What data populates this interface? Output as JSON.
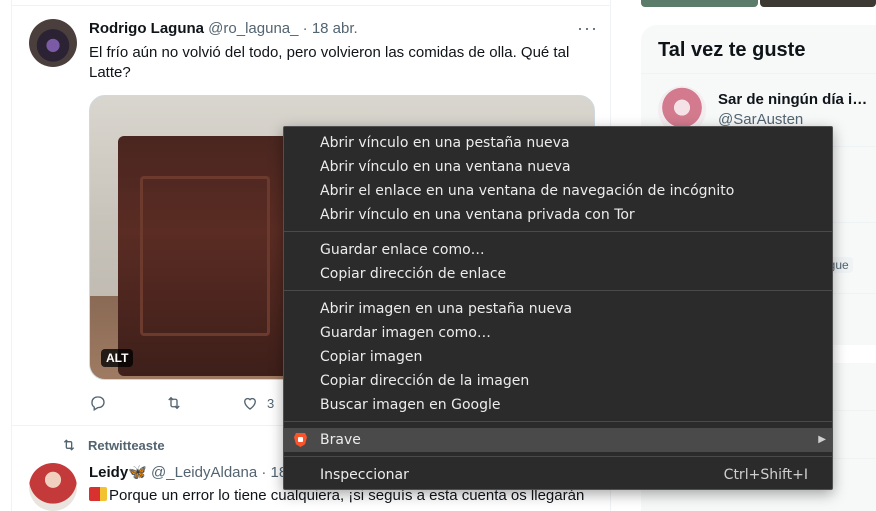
{
  "tweet1": {
    "author": "Rodrigo Laguna",
    "handle": "@ro_laguna_",
    "separator": "·",
    "date": "18 abr.",
    "more": "···",
    "text": "El frío aún no volvió del todo, pero volvieron las comidas de olla. Qué tal Latte?",
    "alt_badge": "ALT",
    "like_count": "3"
  },
  "retweet_label": "Retwitteaste",
  "tweet2": {
    "author": "Leidy",
    "author_emoji": "🦋",
    "handle": "@_LeidyAldana",
    "separator": "·",
    "date": "18",
    "text": "Porque un error lo tiene cualquiera, ¡si seguís a esta cuenta os llegarán"
  },
  "sidebar": {
    "title": "Tal vez te guste",
    "suggestion_name": "Sar de ningún día im…",
    "suggestion_handle": "@SarAusten",
    "partial_name": "a",
    "follows_badge": "sigue"
  },
  "context_menu": {
    "items": [
      "Abrir vínculo en una pestaña nueva",
      "Abrir vínculo en una ventana nueva",
      "Abrir el enlace en una ventana de navegación de incógnito",
      "Abrir vínculo en una ventana privada con Tor",
      "Guardar enlace como…",
      "Copiar dirección de enlace",
      "Abrir imagen en una pestaña nueva",
      "Guardar imagen como…",
      "Copiar imagen",
      "Copiar dirección de la imagen",
      "Buscar imagen en Google",
      "Brave",
      "Inspeccionar"
    ],
    "inspect_shortcut": "Ctrl+Shift+I",
    "highlighted_item": "Brave"
  },
  "colors": {
    "accent_text": "#0f1419",
    "secondary_text": "#536471",
    "menu_bg": "#2b2b2b",
    "brave_orange": "#fb542b"
  }
}
